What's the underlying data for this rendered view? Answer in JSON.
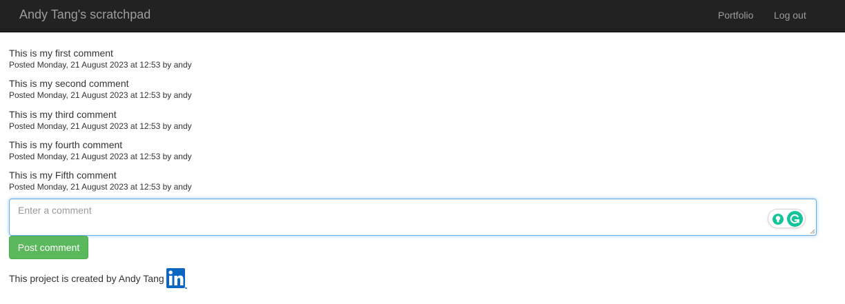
{
  "navbar": {
    "brand": "Andy Tang's scratchpad",
    "links": [
      {
        "label": "Portfolio"
      },
      {
        "label": "Log out"
      }
    ]
  },
  "comments": [
    {
      "text": "This is my first comment",
      "meta": "Posted Monday, 21 August 2023 at 12:53 by andy"
    },
    {
      "text": "This is my second comment",
      "meta": "Posted Monday, 21 August 2023 at 12:53 by andy"
    },
    {
      "text": "This is my third comment",
      "meta": "Posted Monday, 21 August 2023 at 12:53 by andy"
    },
    {
      "text": "This is my fourth comment",
      "meta": "Posted Monday, 21 August 2023 at 12:53 by andy"
    },
    {
      "text": "This is my Fifth comment",
      "meta": "Posted Monday, 21 August 2023 at 12:53 by andy"
    }
  ],
  "form": {
    "placeholder": "Enter a comment",
    "value": "",
    "submit_label": "Post comment",
    "extension_icons": [
      "grammarly-suggestion-icon",
      "grammarly-icon"
    ]
  },
  "footer": {
    "text": "This project is created by Andy Tang",
    "icon": "linkedin-icon"
  },
  "colors": {
    "navbar_bg": "#222222",
    "nav_text": "#9d9d9d",
    "button_green": "#5cb85c",
    "focus_blue": "#66afe9",
    "linkedin_blue": "#0a66c2",
    "grammarly_green": "#15c39a"
  }
}
